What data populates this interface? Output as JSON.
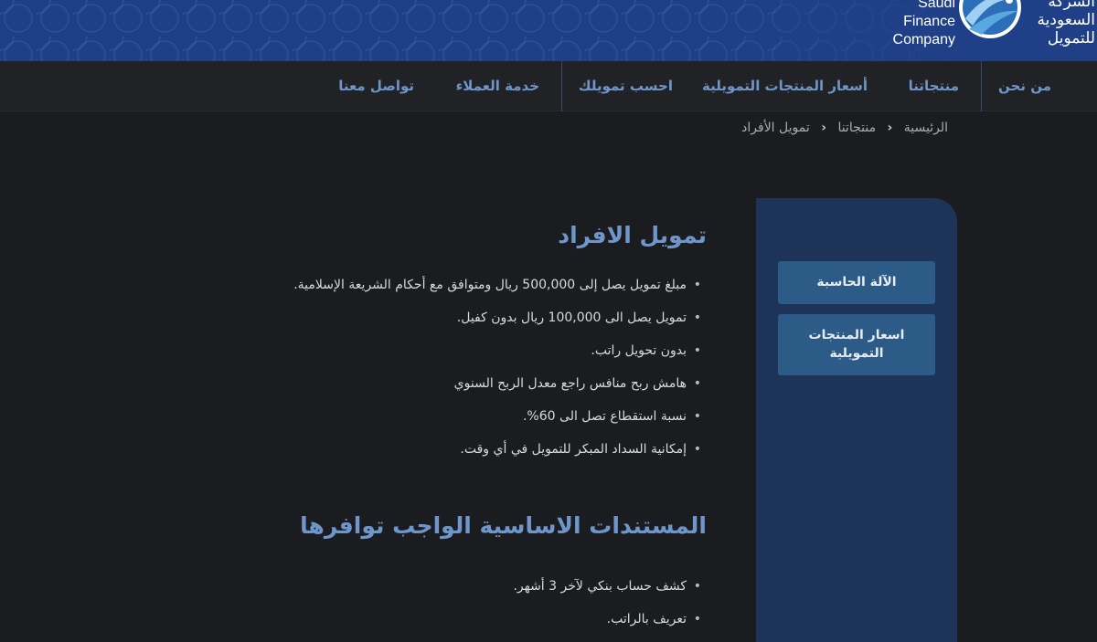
{
  "header": {
    "logo_en": [
      "Saudi",
      "Finance",
      "Company"
    ],
    "logo_ar": [
      "الشركة",
      "السعودية",
      "للتمويل"
    ],
    "brand_color": "#1f3f86"
  },
  "nav": {
    "items": [
      {
        "label": "من نحن"
      },
      {
        "label": "منتجاتنا"
      },
      {
        "label": "أسعار المنتجات التمويلية"
      },
      {
        "label": "احسب تمويلك"
      },
      {
        "label": "خدمة العملاء"
      },
      {
        "label": "تواصل معنا"
      }
    ],
    "accent_color": "#6f96cb"
  },
  "breadcrumb": {
    "items": [
      "الرئيسية",
      "منتجاتنا",
      "تمويل الأفراد"
    ],
    "separator": "‹"
  },
  "sidebar": {
    "buttons": [
      {
        "label": "الآلة الحاسبة"
      },
      {
        "label_line1": "اسعار المنتجات",
        "label_line2": "التمويلية"
      }
    ]
  },
  "main": {
    "section1": {
      "title": "تمويل الافراد",
      "items": [
        "مبلغ تمويل يصل إلى 500,000 ريال ومتوافق مع أحكام الشريعة الإسلامية.",
        "تمويل يصل الى 100,000 ريال بدون كفيل.",
        "بدون تحويل راتب.",
        " هامش ربح منافس راجع معدل الربح السنوي",
        "نسبة استقطاع تصل الى 60%.",
        "إمكانية السداد المبكر للتمويل في أي وقت."
      ]
    },
    "section2": {
      "title": "المستندات الاساسية الواجب توافرها",
      "items": [
        "كشف حساب بنكي لآخر 3 أشهر.",
        "تعريف بالراتب."
      ]
    }
  }
}
